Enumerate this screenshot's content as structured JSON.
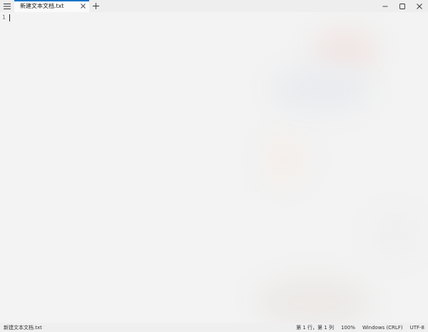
{
  "tab": {
    "title": "新建文本文档.txt"
  },
  "editor": {
    "line_numbers": [
      "1"
    ]
  },
  "statusbar": {
    "file_name": "新建文本文档.txt",
    "position": "第 1 行，第 1 列",
    "zoom": "100%",
    "line_ending": "Windows (CRLF)",
    "encoding": "UTF-8"
  },
  "icons": {
    "menu": "hamburger-menu-icon",
    "tab_close": "close-icon",
    "new_tab": "plus-icon",
    "minimize": "minimize-icon",
    "maximize": "maximize-icon",
    "close": "close-icon"
  },
  "colors": {
    "tab_accent": "#1a73c7",
    "background": "#f3f3f3"
  }
}
